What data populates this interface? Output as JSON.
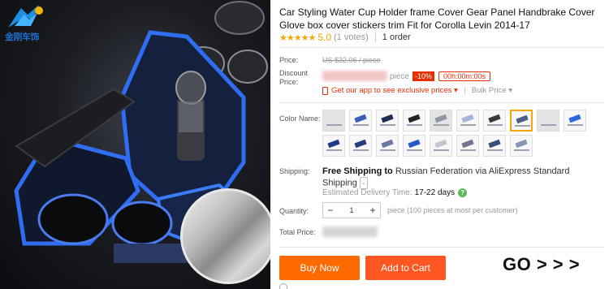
{
  "product": {
    "title": "Car Styling Water Cup Holder frame Cover Gear Panel Handbrake Cover Glove box cover stickers trim Fit for Corolla Levin 2014-17",
    "stars": "★★★★★",
    "rating": "5.0",
    "votes": "(1 votes)",
    "orders": "1 order"
  },
  "logo": {
    "text": "金刚车饰"
  },
  "price": {
    "price_label": "Price:",
    "original_price": "US $32.06 / piece",
    "discount_label": "Discount Price:",
    "unit": "piece",
    "discount_badge": "-10%",
    "countdown": "00h:00m:00s",
    "app_offer": "Get our app to see exclusive prices ▾",
    "bulk_price": "Bulk Price ▾"
  },
  "color": {
    "label": "Color Name:",
    "swatch_count": 18,
    "selected_index": 7
  },
  "shipping": {
    "label": "Shipping:",
    "free": "Free Shipping to",
    "destination": "Russian Federation via AliExpress Standard Shipping",
    "chevron": "⌄",
    "estimate_label": "Estimated Delivery Time:",
    "estimate_days": "17-22 days",
    "help": "?"
  },
  "quantity": {
    "label": "Quantity:",
    "minus": "−",
    "value": "1",
    "plus": "+",
    "note": "piece (100 pieces at most per customer)"
  },
  "total": {
    "label": "Total Price:"
  },
  "actions": {
    "buy_now": "Buy Now",
    "add_to_cart": "Add to Cart",
    "go": "GO > > >"
  },
  "colors": {
    "accent": "#ff6a00",
    "sale_red": "#e62e04",
    "star": "#f4a700",
    "selected_border": "#f6a609"
  }
}
